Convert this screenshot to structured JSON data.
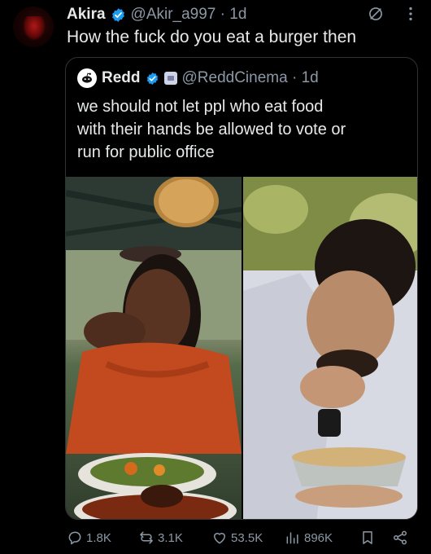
{
  "tweet": {
    "author_name": "Akira",
    "handle_time": "@Akir_a997 · 1d",
    "text": "How the fuck do you eat a burger then",
    "icons": [
      "grok-icon",
      "more-icon"
    ]
  },
  "quote": {
    "author_name": "Redd",
    "handle_time": "@ReddCinema · 1d",
    "text_lines": [
      "we should not let ppl who eat food",
      "with their hands be allowed to vote or",
      "run for public office"
    ]
  },
  "actions": {
    "replies": "1.8K",
    "reposts": "3.1K",
    "likes": "53.5K",
    "views": "896K"
  },
  "colors": {
    "background": "#000000",
    "text": "#e7e9ea",
    "muted": "#8b98a5",
    "verified": "#1d9bf0",
    "border": "#2f3336"
  }
}
